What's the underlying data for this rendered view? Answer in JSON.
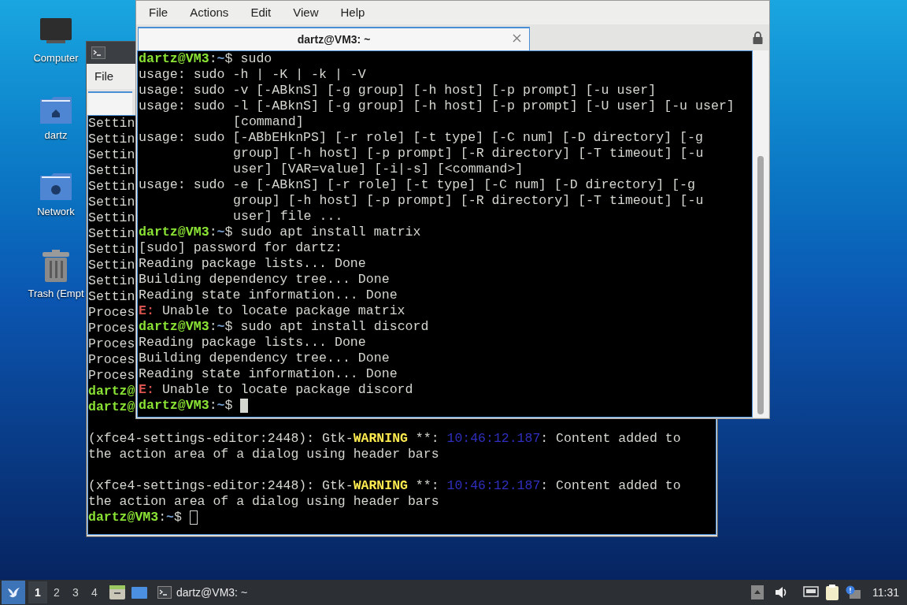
{
  "desktop_icons": [
    {
      "kind": "computer",
      "label": "Computer"
    },
    {
      "kind": "home",
      "label": "dartz"
    },
    {
      "kind": "network",
      "label": "Network"
    },
    {
      "kind": "trash",
      "label": "Trash (Empt"
    }
  ],
  "back_terminal": {
    "focused": false,
    "menu": [
      "File"
    ],
    "lines": [
      {
        "kind": "text",
        "segments": [
          {
            "kind": "plain",
            "text": "Settin"
          }
        ]
      },
      {
        "kind": "text",
        "segments": [
          {
            "kind": "plain",
            "text": "Settin"
          }
        ]
      },
      {
        "kind": "text",
        "segments": [
          {
            "kind": "plain",
            "text": "Settin"
          }
        ]
      },
      {
        "kind": "text",
        "segments": [
          {
            "kind": "plain",
            "text": "Settin"
          }
        ]
      },
      {
        "kind": "text",
        "segments": [
          {
            "kind": "plain",
            "text": "Settin"
          }
        ]
      },
      {
        "kind": "text",
        "segments": [
          {
            "kind": "plain",
            "text": "Settin"
          }
        ]
      },
      {
        "kind": "text",
        "segments": [
          {
            "kind": "plain",
            "text": "Settin"
          }
        ]
      },
      {
        "kind": "text",
        "segments": [
          {
            "kind": "plain",
            "text": "Settin"
          }
        ]
      },
      {
        "kind": "text",
        "segments": [
          {
            "kind": "plain",
            "text": "Settin"
          }
        ]
      },
      {
        "kind": "text",
        "segments": [
          {
            "kind": "plain",
            "text": "Settin"
          }
        ]
      },
      {
        "kind": "text",
        "segments": [
          {
            "kind": "plain",
            "text": "Settin"
          }
        ]
      },
      {
        "kind": "text",
        "segments": [
          {
            "kind": "plain",
            "text": "Settin"
          }
        ]
      },
      {
        "kind": "text",
        "segments": [
          {
            "kind": "plain",
            "text": "Proces"
          }
        ]
      },
      {
        "kind": "text",
        "segments": [
          {
            "kind": "plain",
            "text": "Proces"
          }
        ]
      },
      {
        "kind": "text",
        "segments": [
          {
            "kind": "plain",
            "text": "Proces"
          }
        ]
      },
      {
        "kind": "text",
        "segments": [
          {
            "kind": "plain",
            "text": "Proces"
          }
        ]
      },
      {
        "kind": "text",
        "segments": [
          {
            "kind": "plain",
            "text": "Proces"
          }
        ]
      },
      {
        "kind": "text",
        "segments": [
          {
            "kind": "user",
            "text": "dartz@"
          }
        ]
      },
      {
        "kind": "text",
        "segments": [
          {
            "kind": "user",
            "text": "dartz@"
          }
        ]
      },
      {
        "kind": "blank"
      },
      {
        "kind": "text",
        "segments": [
          {
            "kind": "plain",
            "text": "(xfce4-settings-editor:2448): Gtk-"
          },
          {
            "kind": "warning",
            "text": "WARNING"
          },
          {
            "kind": "plain",
            "text": " **: "
          },
          {
            "kind": "time",
            "text": "10:46:12.187"
          },
          {
            "kind": "plain",
            "text": ": Content added to"
          }
        ]
      },
      {
        "kind": "text",
        "segments": [
          {
            "kind": "plain",
            "text": "the action area of a dialog using header bars"
          }
        ]
      },
      {
        "kind": "blank"
      },
      {
        "kind": "text",
        "segments": [
          {
            "kind": "plain",
            "text": "(xfce4-settings-editor:2448): Gtk-"
          },
          {
            "kind": "warning",
            "text": "WARNING"
          },
          {
            "kind": "plain",
            "text": " **: "
          },
          {
            "kind": "time",
            "text": "10:46:12.187"
          },
          {
            "kind": "plain",
            "text": ": Content added to"
          }
        ]
      },
      {
        "kind": "text",
        "segments": [
          {
            "kind": "plain",
            "text": "the action area of a dialog using header bars"
          }
        ]
      },
      {
        "kind": "text",
        "cursor": true,
        "segments": [
          {
            "kind": "user",
            "text": "dartz@VM3"
          },
          {
            "kind": "plain",
            "text": ":"
          },
          {
            "kind": "path",
            "text": "~"
          },
          {
            "kind": "plain",
            "text": "$ "
          }
        ]
      }
    ]
  },
  "front_terminal": {
    "focused": true,
    "menu": [
      "File",
      "Actions",
      "Edit",
      "View",
      "Help"
    ],
    "tab_title": "dartz@VM3: ~",
    "lines": [
      {
        "kind": "text",
        "segments": [
          {
            "kind": "user",
            "text": "dartz@VM3"
          },
          {
            "kind": "plain",
            "text": ":"
          },
          {
            "kind": "path",
            "text": "~"
          },
          {
            "kind": "plain",
            "text": "$ sudo"
          }
        ]
      },
      {
        "kind": "text",
        "segments": [
          {
            "kind": "plain",
            "text": "usage: sudo -h | -K | -k | -V"
          }
        ]
      },
      {
        "kind": "text",
        "segments": [
          {
            "kind": "plain",
            "text": "usage: sudo -v [-ABknS] [-g group] [-h host] [-p prompt] [-u user]"
          }
        ]
      },
      {
        "kind": "text",
        "segments": [
          {
            "kind": "plain",
            "text": "usage: sudo -l [-ABknS] [-g group] [-h host] [-p prompt] [-U user] [-u user]"
          }
        ]
      },
      {
        "kind": "wrap",
        "segments": [
          {
            "kind": "plain",
            "text": "[command]"
          }
        ]
      },
      {
        "kind": "text",
        "segments": [
          {
            "kind": "plain",
            "text": "usage: sudo [-ABbEHknPS] [-r role] [-t type] [-C num] [-D directory] [-g"
          }
        ]
      },
      {
        "kind": "wrap",
        "segments": [
          {
            "kind": "plain",
            "text": "group] [-h host] [-p prompt] [-R directory] [-T timeout] [-u"
          }
        ]
      },
      {
        "kind": "wrap",
        "segments": [
          {
            "kind": "plain",
            "text": "user] [VAR=value] [-i|-s] [<command>]"
          }
        ]
      },
      {
        "kind": "text",
        "segments": [
          {
            "kind": "plain",
            "text": "usage: sudo -e [-ABknS] [-r role] [-t type] [-C num] [-D directory] [-g"
          }
        ]
      },
      {
        "kind": "wrap",
        "segments": [
          {
            "kind": "plain",
            "text": "group] [-h host] [-p prompt] [-R directory] [-T timeout] [-u"
          }
        ]
      },
      {
        "kind": "wrap",
        "segments": [
          {
            "kind": "plain",
            "text": "user] file ..."
          }
        ]
      },
      {
        "kind": "text",
        "segments": [
          {
            "kind": "user",
            "text": "dartz@VM3"
          },
          {
            "kind": "plain",
            "text": ":"
          },
          {
            "kind": "path",
            "text": "~"
          },
          {
            "kind": "plain",
            "text": "$ sudo apt install matrix"
          }
        ]
      },
      {
        "kind": "text",
        "segments": [
          {
            "kind": "plain",
            "text": "[sudo] password for dartz:"
          }
        ]
      },
      {
        "kind": "text",
        "segments": [
          {
            "kind": "plain",
            "text": "Reading package lists... Done"
          }
        ]
      },
      {
        "kind": "text",
        "segments": [
          {
            "kind": "plain",
            "text": "Building dependency tree... Done"
          }
        ]
      },
      {
        "kind": "text",
        "segments": [
          {
            "kind": "plain",
            "text": "Reading state information... Done"
          }
        ]
      },
      {
        "kind": "text",
        "segments": [
          {
            "kind": "error",
            "text": "E:"
          },
          {
            "kind": "plain",
            "text": " Unable to locate package matrix"
          }
        ]
      },
      {
        "kind": "text",
        "segments": [
          {
            "kind": "user",
            "text": "dartz@VM3"
          },
          {
            "kind": "plain",
            "text": ":"
          },
          {
            "kind": "path",
            "text": "~"
          },
          {
            "kind": "plain",
            "text": "$ sudo apt install discord"
          }
        ]
      },
      {
        "kind": "text",
        "segments": [
          {
            "kind": "plain",
            "text": "Reading package lists... Done"
          }
        ]
      },
      {
        "kind": "text",
        "segments": [
          {
            "kind": "plain",
            "text": "Building dependency tree... Done"
          }
        ]
      },
      {
        "kind": "text",
        "segments": [
          {
            "kind": "plain",
            "text": "Reading state information... Done"
          }
        ]
      },
      {
        "kind": "text",
        "segments": [
          {
            "kind": "error",
            "text": "E:"
          },
          {
            "kind": "plain",
            "text": " Unable to locate package discord"
          }
        ]
      },
      {
        "kind": "text",
        "cursor": true,
        "segments": [
          {
            "kind": "user",
            "text": "dartz@VM3"
          },
          {
            "kind": "plain",
            "text": ":"
          },
          {
            "kind": "path",
            "text": "~"
          },
          {
            "kind": "plain",
            "text": "$ "
          }
        ]
      }
    ]
  },
  "taskbar": {
    "workspaces": [
      {
        "label": "1",
        "selected": true
      },
      {
        "label": "2",
        "selected": false
      },
      {
        "label": "3",
        "selected": false
      },
      {
        "label": "4",
        "selected": false
      }
    ],
    "task": "dartz@VM3: ~",
    "clock": "11:31"
  }
}
